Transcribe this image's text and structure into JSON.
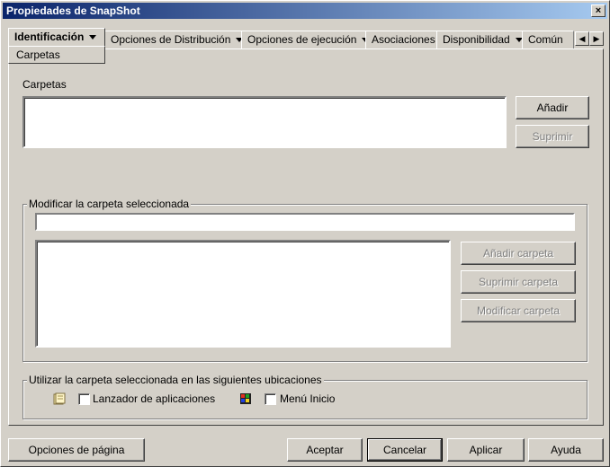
{
  "window": {
    "title": "Propiedades de SnapShot",
    "close_label": "×"
  },
  "tabs": [
    {
      "label": "Identificación"
    },
    {
      "label": "Opciones de Distribución"
    },
    {
      "label": "Opciones de ejecución"
    },
    {
      "label": "Asociaciones"
    },
    {
      "label": "Disponibilidad"
    },
    {
      "label": "Común"
    }
  ],
  "subtab": {
    "label": "Carpetas"
  },
  "carpetas": {
    "label": "Carpetas",
    "add_button": "Añadir",
    "delete_button": "Suprimir"
  },
  "modify_group": {
    "label": "Modificar la carpeta seleccionada",
    "path_value": "",
    "add_folder": "Añadir carpeta",
    "delete_folder": "Suprimir carpeta",
    "modify_folder": "Modificar carpeta"
  },
  "locations_group": {
    "label": "Utilizar la carpeta seleccionada en las siguientes ubicaciones",
    "launcher_label": "Lanzador de aplicaciones",
    "start_menu_label": "Menú Inicio"
  },
  "footer": {
    "page_options": "Opciones de página",
    "accept": "Aceptar",
    "cancel": "Cancelar",
    "apply": "Aplicar",
    "help": "Ayuda"
  }
}
